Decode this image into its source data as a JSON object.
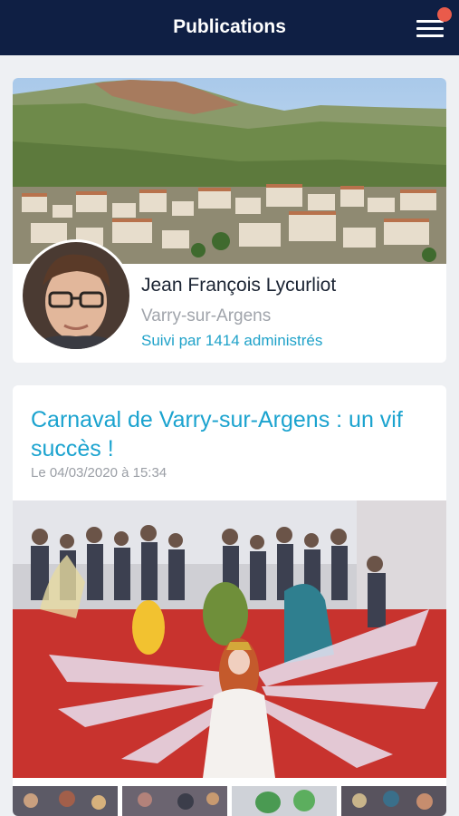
{
  "header": {
    "title": "Publications",
    "menu_icon": "hamburger-menu-icon",
    "notification_badge_color": "#e95b4b"
  },
  "profile": {
    "name": "Jean François Lycurliot",
    "city": "Varry-sur-Argens",
    "followers": "Suivi par 1414 administrés"
  },
  "post": {
    "title": "Carnaval de Varry-sur-Argens : un vif succès !",
    "date": "Le 04/03/2020 à 15:34"
  },
  "colors": {
    "header_bg": "#0f1f44",
    "accent": "#1ba3cf",
    "background": "#eef0f3"
  }
}
